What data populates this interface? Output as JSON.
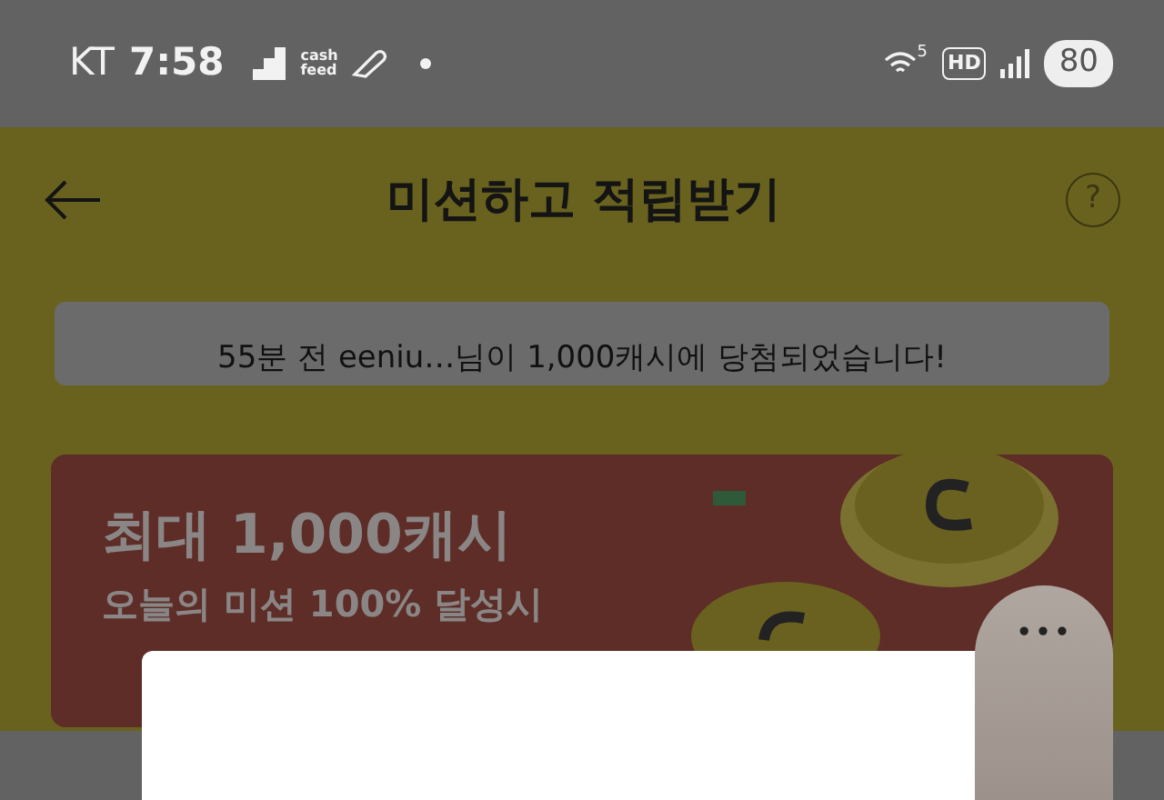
{
  "status_bar": {
    "carrier": "KT",
    "time": "7:58",
    "app_label": "cash feed",
    "network": "HD",
    "wifi_badge": "5",
    "battery": "80"
  },
  "header": {
    "title": "미션하고 적립받기",
    "help": "?"
  },
  "toast": {
    "text": "55분 전 eeniu…님이 1,000캐시에 당첨되었습니다!"
  },
  "banner": {
    "headline": "최대 1,000캐시",
    "subline": "오늘의 미션 100% 달성시"
  },
  "side_handle": {
    "label": "•••"
  }
}
